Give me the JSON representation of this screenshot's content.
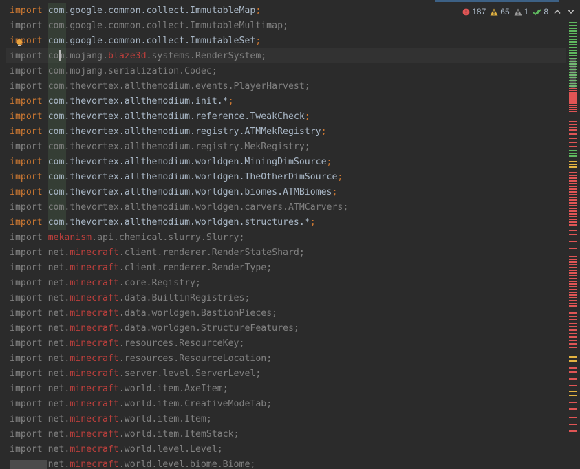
{
  "inspection": {
    "errors": "187",
    "warnings": "65",
    "weak_warnings": "1",
    "ok": "8"
  },
  "colors": {
    "background": "#2b2b2b",
    "keyword": "#cc7832",
    "unused": "#808080",
    "text": "#a9b7c6",
    "error": "#bc3f3c",
    "error_icon": "#e05555",
    "warning_icon": "#e3b341",
    "ok_icon": "#5fb85f"
  },
  "lines": [
    {
      "status": "used",
      "keyword": "import",
      "parts": [
        {
          "t": "com",
          "c": "pk"
        },
        {
          "t": ".google.common.collect.ImmutableMap",
          "c": "pk"
        }
      ]
    },
    {
      "status": "unused",
      "keyword": "import",
      "parts": [
        {
          "t": "com",
          "c": "pk"
        },
        {
          "t": ".google.common.collect.ImmutableMultimap",
          "c": "pk"
        }
      ]
    },
    {
      "status": "used",
      "keyword": "import",
      "parts": [
        {
          "t": "com",
          "c": "pk"
        },
        {
          "t": ".google.common.collect.ImmutableSet",
          "c": "pk"
        }
      ]
    },
    {
      "status": "unused",
      "keyword": "import",
      "parts": [
        {
          "t": "com",
          "c": "pk"
        },
        {
          "t": ".mojang.",
          "c": "pk"
        },
        {
          "t": "blaze3d",
          "c": "err"
        },
        {
          "t": ".systems.RenderSystem",
          "c": "pk"
        }
      ]
    },
    {
      "status": "unused",
      "keyword": "import",
      "parts": [
        {
          "t": "com",
          "c": "pk"
        },
        {
          "t": ".mojang.serialization.Codec",
          "c": "pk"
        }
      ]
    },
    {
      "status": "unused",
      "keyword": "import",
      "parts": [
        {
          "t": "com",
          "c": "pk"
        },
        {
          "t": ".thevortex.allthemodium.events.PlayerHarvest",
          "c": "pk"
        }
      ]
    },
    {
      "status": "used",
      "keyword": "import",
      "parts": [
        {
          "t": "com",
          "c": "pk"
        },
        {
          "t": ".thevortex.allthemodium.init.*",
          "c": "pk"
        }
      ]
    },
    {
      "status": "used",
      "keyword": "import",
      "parts": [
        {
          "t": "com",
          "c": "pk"
        },
        {
          "t": ".thevortex.allthemodium.reference.TweakCheck",
          "c": "pk"
        }
      ]
    },
    {
      "status": "used",
      "keyword": "import",
      "parts": [
        {
          "t": "com",
          "c": "pk"
        },
        {
          "t": ".thevortex.allthemodium.registry.ATMMekRegistry",
          "c": "pk"
        }
      ]
    },
    {
      "status": "unused",
      "keyword": "import",
      "parts": [
        {
          "t": "com",
          "c": "pk"
        },
        {
          "t": ".thevortex.allthemodium.registry.MekRegistry",
          "c": "pk"
        }
      ]
    },
    {
      "status": "used",
      "keyword": "import",
      "parts": [
        {
          "t": "com",
          "c": "pk"
        },
        {
          "t": ".thevortex.allthemodium.worldgen.MiningDimSource",
          "c": "pk"
        }
      ]
    },
    {
      "status": "used",
      "keyword": "import",
      "parts": [
        {
          "t": "com",
          "c": "pk"
        },
        {
          "t": ".thevortex.allthemodium.worldgen.TheOtherDimSource",
          "c": "pk"
        }
      ]
    },
    {
      "status": "used",
      "keyword": "import",
      "parts": [
        {
          "t": "com",
          "c": "pk"
        },
        {
          "t": ".thevortex.allthemodium.worldgen.biomes.ATMBiomes",
          "c": "pk"
        }
      ]
    },
    {
      "status": "unused",
      "keyword": "import",
      "parts": [
        {
          "t": "com",
          "c": "pk"
        },
        {
          "t": ".thevortex.allthemodium.worldgen.carvers.ATMCarvers",
          "c": "pk"
        }
      ]
    },
    {
      "status": "used",
      "keyword": "import",
      "parts": [
        {
          "t": "com",
          "c": "pk"
        },
        {
          "t": ".thevortex.allthemodium.worldgen.structures.*",
          "c": "pk"
        }
      ]
    },
    {
      "status": "unused",
      "keyword": "import",
      "parts": [
        {
          "t": "mekanism",
          "c": "err"
        },
        {
          "t": ".api.chemical.slurry.Slurry",
          "c": "pk"
        }
      ]
    },
    {
      "status": "unused",
      "keyword": "import",
      "parts": [
        {
          "t": "net.",
          "c": "pk"
        },
        {
          "t": "minecraft",
          "c": "err"
        },
        {
          "t": ".client.renderer.RenderStateShard",
          "c": "pk"
        }
      ]
    },
    {
      "status": "unused",
      "keyword": "import",
      "parts": [
        {
          "t": "net.",
          "c": "pk"
        },
        {
          "t": "minecraft",
          "c": "err"
        },
        {
          "t": ".client.renderer.RenderType",
          "c": "pk"
        }
      ]
    },
    {
      "status": "unused",
      "keyword": "import",
      "parts": [
        {
          "t": "net.",
          "c": "pk"
        },
        {
          "t": "minecraft",
          "c": "err"
        },
        {
          "t": ".core.Registry",
          "c": "pk"
        }
      ]
    },
    {
      "status": "unused",
      "keyword": "import",
      "parts": [
        {
          "t": "net.",
          "c": "pk"
        },
        {
          "t": "minecraft",
          "c": "err"
        },
        {
          "t": ".data.BuiltinRegistries",
          "c": "pk"
        }
      ]
    },
    {
      "status": "unused",
      "keyword": "import",
      "parts": [
        {
          "t": "net.",
          "c": "pk"
        },
        {
          "t": "minecraft",
          "c": "err"
        },
        {
          "t": ".data.worldgen.BastionPieces",
          "c": "pk"
        }
      ]
    },
    {
      "status": "unused",
      "keyword": "import",
      "parts": [
        {
          "t": "net.",
          "c": "pk"
        },
        {
          "t": "minecraft",
          "c": "err"
        },
        {
          "t": ".data.worldgen.StructureFeatures",
          "c": "pk"
        }
      ]
    },
    {
      "status": "unused",
      "keyword": "import",
      "parts": [
        {
          "t": "net.",
          "c": "pk"
        },
        {
          "t": "minecraft",
          "c": "err"
        },
        {
          "t": ".resources.ResourceKey",
          "c": "pk"
        }
      ]
    },
    {
      "status": "unused",
      "keyword": "import",
      "parts": [
        {
          "t": "net.",
          "c": "pk"
        },
        {
          "t": "minecraft",
          "c": "err"
        },
        {
          "t": ".resources.ResourceLocation",
          "c": "pk"
        }
      ]
    },
    {
      "status": "unused",
      "keyword": "import",
      "parts": [
        {
          "t": "net.",
          "c": "pk"
        },
        {
          "t": "minecraft",
          "c": "err"
        },
        {
          "t": ".server.level.ServerLevel",
          "c": "pk"
        }
      ]
    },
    {
      "status": "unused",
      "keyword": "import",
      "parts": [
        {
          "t": "net.",
          "c": "pk"
        },
        {
          "t": "minecraft",
          "c": "err"
        },
        {
          "t": ".world.item.AxeItem",
          "c": "pk"
        }
      ]
    },
    {
      "status": "unused",
      "keyword": "import",
      "parts": [
        {
          "t": "net.",
          "c": "pk"
        },
        {
          "t": "minecraft",
          "c": "err"
        },
        {
          "t": ".world.item.CreativeModeTab",
          "c": "pk"
        }
      ]
    },
    {
      "status": "unused",
      "keyword": "import",
      "parts": [
        {
          "t": "net.",
          "c": "pk"
        },
        {
          "t": "minecraft",
          "c": "err"
        },
        {
          "t": ".world.item.Item",
          "c": "pk"
        }
      ]
    },
    {
      "status": "unused",
      "keyword": "import",
      "parts": [
        {
          "t": "net.",
          "c": "pk"
        },
        {
          "t": "minecraft",
          "c": "err"
        },
        {
          "t": ".world.item.ItemStack",
          "c": "pk"
        }
      ]
    },
    {
      "status": "unused",
      "keyword": "import",
      "parts": [
        {
          "t": "net.",
          "c": "pk"
        },
        {
          "t": "minecraft",
          "c": "err"
        },
        {
          "t": ".world.level.Level",
          "c": "pk"
        }
      ]
    },
    {
      "status": "unused",
      "keyword": "import",
      "parts": [
        {
          "t": "net.",
          "c": "pk"
        },
        {
          "t": "minecraft",
          "c": "err"
        },
        {
          "t": ".world.level.biome.Biome",
          "c": "pk"
        }
      ]
    }
  ]
}
